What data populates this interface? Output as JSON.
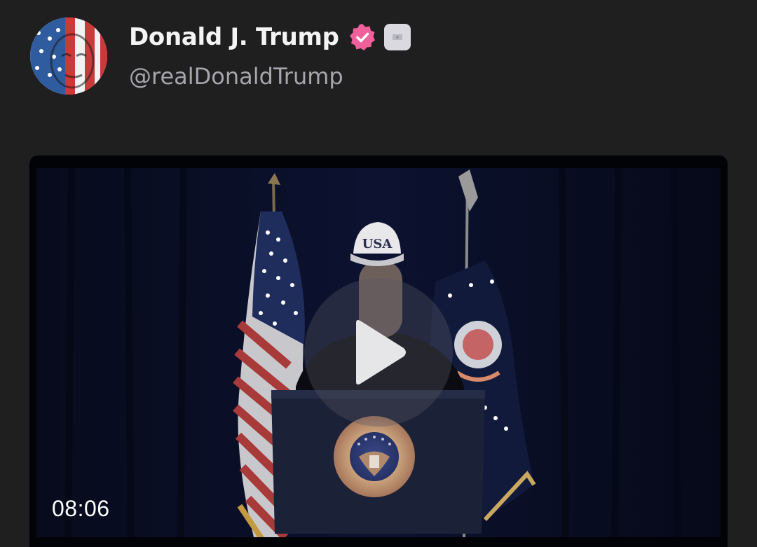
{
  "post": {
    "author": {
      "display_name": "Donald J. Trump",
      "handle": "@realDonaldTrump",
      "avatar_icon": "flag-face-avatar",
      "verified_icon": "verified-badge-icon",
      "verified_color": "#f0609a",
      "secondary_badge_icon": "affiliation-badge-icon"
    },
    "media": {
      "type": "video",
      "duration": "08:06",
      "play_icon": "play-icon",
      "cap_text": "USA"
    }
  }
}
